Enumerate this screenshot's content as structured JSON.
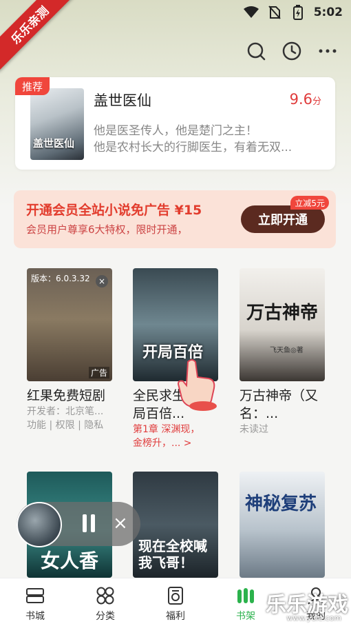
{
  "status_bar": {
    "time": "5:02"
  },
  "ribbon": "乐乐亲测",
  "recommend": {
    "badge": "推荐",
    "cover_text": "盖世医仙",
    "title": "盖世医仙",
    "score": "9.6",
    "score_unit": "分",
    "desc_line1": "他是医圣传人，他是楚门之主！",
    "desc_line2": "他是农村长大的行脚医生，有着无双..."
  },
  "vip": {
    "title": "开通会员全站小说免广告 ¥15",
    "subtitle": "会员用户尊享6大特权，限时开通，",
    "button": "立即开通",
    "tag": "立减5元"
  },
  "books_row1": [
    {
      "title": "红果免费短剧",
      "sub1": "开发者：北京笔...",
      "sub2": "功能 | 权限 | 隐私",
      "ad_version": "版本：6.0.3.32",
      "ad_label": "广告",
      "ad_close": "×"
    },
    {
      "title": "全民求生：开局百倍...",
      "sub1": "第1章 深渊现，",
      "sub2": "金榜升，... >",
      "cover_text": "开局百倍"
    },
    {
      "title": "万古神帝（又名：...",
      "sub1": "未读过",
      "cover_text": "万古神帝",
      "cover_author": "飞天鱼◎著"
    }
  ],
  "books_row2": [
    {
      "cover_text": "女人香"
    },
    {
      "cover_text": "现在全校喊我飞哥！"
    },
    {
      "cover_text": "神秘复苏"
    }
  ],
  "player": {
    "close": "×"
  },
  "nav": [
    {
      "label": "书城",
      "icon": "store-icon"
    },
    {
      "label": "分类",
      "icon": "category-icon"
    },
    {
      "label": "福利",
      "icon": "gift-icon"
    },
    {
      "label": "书架",
      "icon": "bookshelf-icon"
    },
    {
      "label": "我的",
      "icon": "profile-icon"
    }
  ],
  "watermark": "乐乐游戏",
  "watermark_url": "www.yule.com",
  "colors": {
    "accent_green": "#2bb24c",
    "accent_red": "#e03c3c",
    "vip_btn": "#5b2a20"
  }
}
